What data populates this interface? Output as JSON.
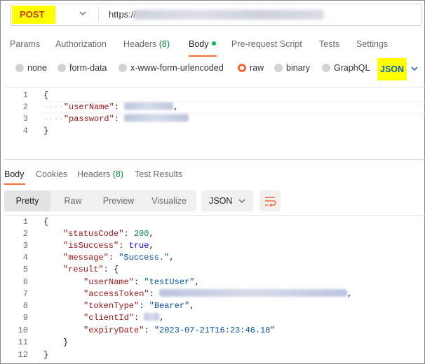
{
  "request": {
    "method": "POST",
    "url_prefix": "https://"
  },
  "request_tabs": [
    {
      "label": "Params"
    },
    {
      "label": "Authorization"
    },
    {
      "label": "Headers",
      "count": "(8)"
    },
    {
      "label": "Body"
    },
    {
      "label": "Pre-request Script"
    },
    {
      "label": "Tests"
    },
    {
      "label": "Settings"
    }
  ],
  "body_types": [
    "none",
    "form-data",
    "x-www-form-urlencoded",
    "raw",
    "binary",
    "GraphQL"
  ],
  "body_format": "JSON",
  "request_body": {
    "line_numbers": [
      "1",
      "2",
      "3",
      "4"
    ],
    "open_brace": "{",
    "close_brace": "}",
    "username_key": "\"userName\"",
    "password_key": "\"password\"",
    "colon": ":",
    "comma": ","
  },
  "response_tabs": [
    {
      "label": "Body"
    },
    {
      "label": "Cookies"
    },
    {
      "label": "Headers",
      "count": "(8)"
    },
    {
      "label": "Test Results"
    }
  ],
  "view_modes": [
    "Pretty",
    "Raw",
    "Preview",
    "Visualize"
  ],
  "response_format": "JSON",
  "response_body": {
    "line_numbers": [
      "1",
      "2",
      "3",
      "4",
      "5",
      "6",
      "7",
      "8",
      "9",
      "10",
      "11",
      "12"
    ],
    "status_key": "\"statusCode\"",
    "status_value": "200",
    "success_key": "\"isSuccess\"",
    "success_value": "true",
    "message_key": "\"message\"",
    "message_value": "\"Success.\"",
    "result_key": "\"result\"",
    "username_key": "\"userName\"",
    "username_value": "\"testUser\"",
    "token_key": "\"accessToken\"",
    "token_type_key": "\"tokenType\"",
    "token_type_value": "\"Bearer\"",
    "client_key": "\"clientId\"",
    "expiry_key": "\"expiryDate\"",
    "expiry_value": "\"2023-07-21T16:23:46.18\""
  },
  "colors": {
    "highlight": "#ffff00",
    "method": "#c2401c",
    "accent": "#ff6c37",
    "json_key": "#a31515",
    "json_string": "#0451a5",
    "json_number": "#098658",
    "json_bool": "#0000ff"
  }
}
